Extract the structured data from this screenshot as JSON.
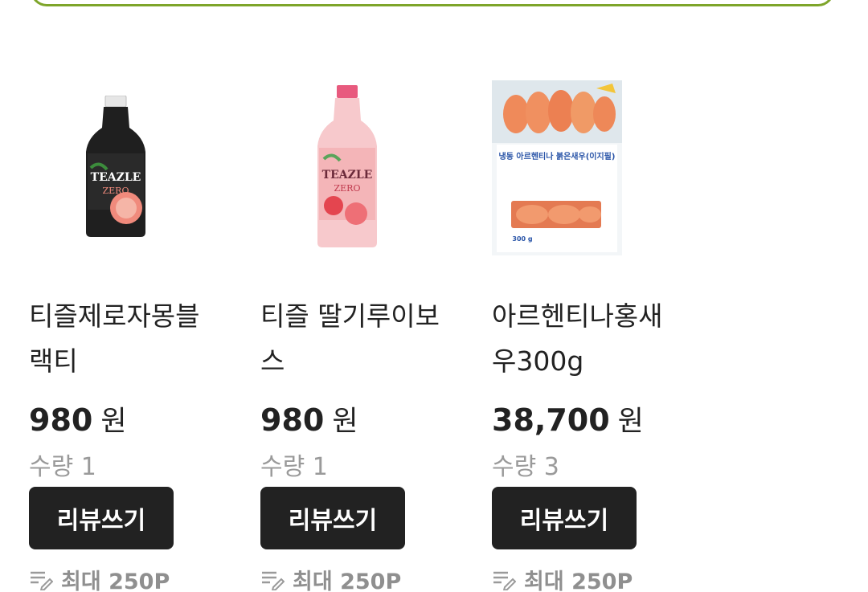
{
  "products": [
    {
      "name": "티즐제로자몽블랙티",
      "price": "980",
      "unit": "원",
      "qty": "수량 1",
      "review_label": "리뷰쓰기",
      "points": "최대 250P",
      "bottle_label": "TEAZLE",
      "bottle_sub": "ZERO"
    },
    {
      "name": "티즐 딸기루이보스",
      "price": "980",
      "unit": "원",
      "qty": "수량 1",
      "review_label": "리뷰쓰기",
      "points": "최대 250P",
      "bottle_label": "TEAZLE",
      "bottle_sub": "ZERO"
    },
    {
      "name": "아르헨티나홍새우300g",
      "price": "38,700",
      "unit": "원",
      "qty": "수량 3",
      "review_label": "리뷰쓰기",
      "points": "최대 250P",
      "pack_title": "냉동 아르헨티나 붉은새우(이지필)",
      "pack_weight": "300 g"
    }
  ],
  "colors": {
    "accent_border": "#7ea52a",
    "button_bg": "#222222",
    "muted_text": "#9a9a9a"
  },
  "icons": {
    "points_icon": "pencil-lines-icon"
  }
}
